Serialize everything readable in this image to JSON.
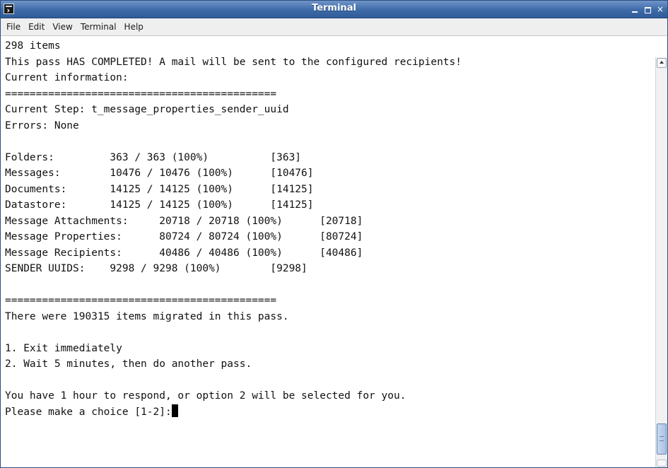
{
  "window": {
    "title": "Terminal",
    "icon": "terminal-icon",
    "controls": {
      "minimize": "minimize-icon",
      "maximize": "maximize-icon",
      "close": "×"
    }
  },
  "menubar": {
    "items": [
      "File",
      "Edit",
      "View",
      "Terminal",
      "Help"
    ]
  },
  "terminal": {
    "lines": [
      "298 items",
      "This pass HAS COMPLETED! A mail will be sent to the configured recipients!",
      "Current information:",
      "============================================",
      "Current Step: t_message_properties_sender_uuid",
      "Errors: None",
      "",
      "Folders:         363 / 363 (100%)          [363]",
      "Messages:        10476 / 10476 (100%)      [10476]",
      "Documents:       14125 / 14125 (100%)      [14125]",
      "Datastore:       14125 / 14125 (100%)      [14125]",
      "Message Attachments:     20718 / 20718 (100%)      [20718]",
      "Message Properties:      80724 / 80724 (100%)      [80724]",
      "Message Recipients:      40486 / 40486 (100%)      [40486]",
      "SENDER UUIDS:    9298 / 9298 (100%)        [9298]",
      "",
      "============================================",
      "There were 190315 items migrated in this pass.",
      "",
      "1. Exit immediately",
      "2. Wait 5 minutes, then do another pass.",
      "",
      "You have 1 hour to respond, or option 2 will be selected for you."
    ],
    "prompt": "Please make a choice [1-2]:"
  }
}
